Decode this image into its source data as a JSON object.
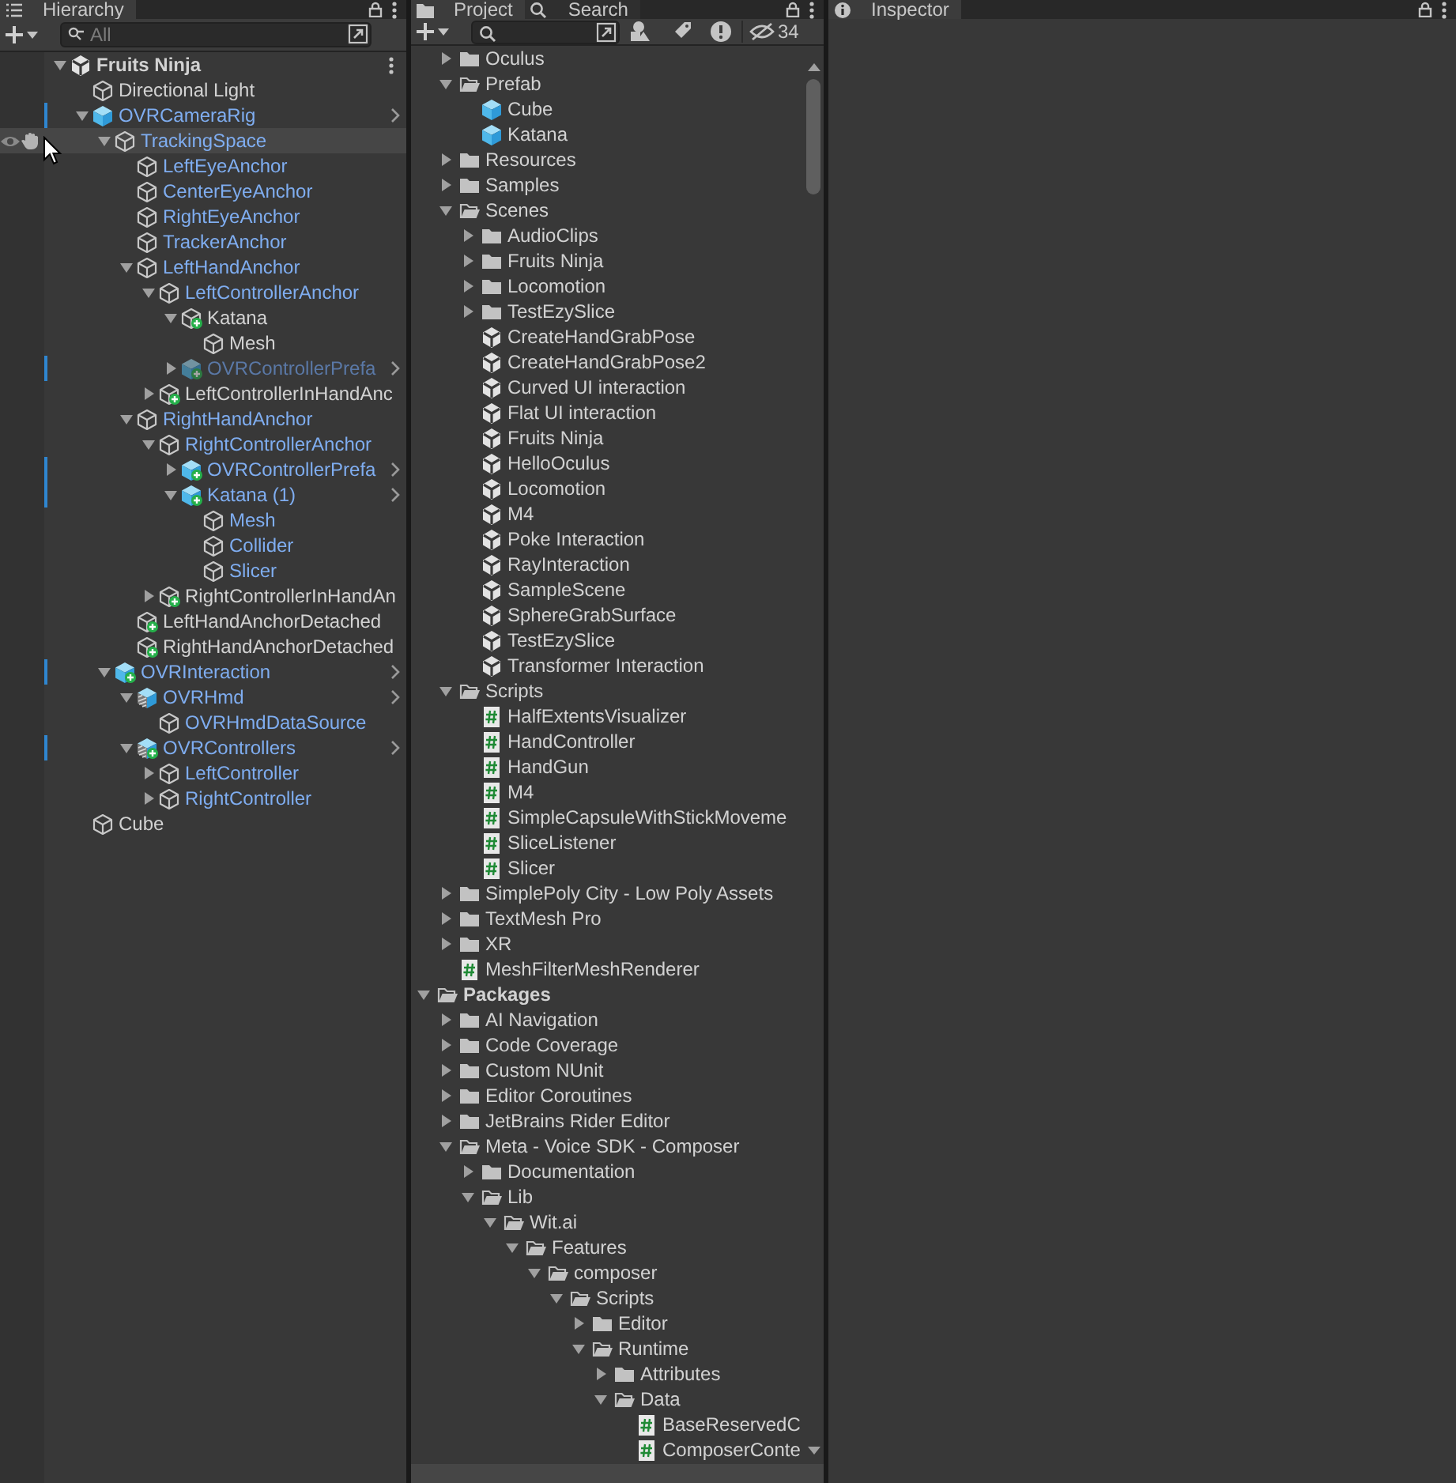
{
  "hierarchy": {
    "tab": {
      "label": "Hierarchy",
      "selected": true
    },
    "search": {
      "placeholder": "All"
    },
    "scene": {
      "name": "Fruits Ninja",
      "expanded": true,
      "children": [
        {
          "name": "Directional Light",
          "kind": "cube",
          "linked": false,
          "overridden": false,
          "chevron": false,
          "inactive": false,
          "hovered": false
        },
        {
          "name": "OVRCameraRig",
          "kind": "prefab",
          "linked": true,
          "overridden": true,
          "chevron": true,
          "inactive": false,
          "hovered": false,
          "expanded": true,
          "children": [
            {
              "name": "TrackingSpace",
              "kind": "cube",
              "linked": true,
              "overridden": false,
              "chevron": false,
              "inactive": false,
              "hovered": true,
              "expanded": true,
              "children": [
                {
                  "name": "LeftEyeAnchor",
                  "kind": "cube",
                  "linked": true,
                  "overridden": false,
                  "chevron": false,
                  "inactive": false,
                  "hovered": false
                },
                {
                  "name": "CenterEyeAnchor",
                  "kind": "cube",
                  "linked": true,
                  "overridden": false,
                  "chevron": false,
                  "inactive": false,
                  "hovered": false
                },
                {
                  "name": "RightEyeAnchor",
                  "kind": "cube",
                  "linked": true,
                  "overridden": false,
                  "chevron": false,
                  "inactive": false,
                  "hovered": false
                },
                {
                  "name": "TrackerAnchor",
                  "kind": "cube",
                  "linked": true,
                  "overridden": false,
                  "chevron": false,
                  "inactive": false,
                  "hovered": false
                },
                {
                  "name": "LeftHandAnchor",
                  "kind": "cube",
                  "linked": true,
                  "overridden": false,
                  "chevron": false,
                  "inactive": false,
                  "hovered": false,
                  "expanded": true,
                  "children": [
                    {
                      "name": "LeftControllerAnchor",
                      "kind": "cube",
                      "linked": true,
                      "overridden": false,
                      "chevron": false,
                      "inactive": false,
                      "hovered": false,
                      "expanded": true,
                      "children": [
                        {
                          "name": "Katana",
                          "kind": "cube-added",
                          "linked": false,
                          "overridden": false,
                          "chevron": false,
                          "inactive": false,
                          "hovered": false,
                          "expanded": true,
                          "children": [
                            {
                              "name": "Mesh",
                              "kind": "cube",
                              "linked": false,
                              "overridden": false,
                              "chevron": false,
                              "inactive": false,
                              "hovered": false
                            }
                          ]
                        },
                        {
                          "name": "OVRControllerPrefa",
                          "kind": "prefab-added",
                          "linked": true,
                          "overridden": true,
                          "chevron": true,
                          "inactive": true,
                          "hovered": false,
                          "expanded": false
                        }
                      ]
                    },
                    {
                      "name": "LeftControllerInHandAnc",
                      "kind": "cube-added",
                      "linked": false,
                      "overridden": false,
                      "chevron": false,
                      "inactive": false,
                      "hovered": false,
                      "expanded": false
                    }
                  ]
                },
                {
                  "name": "RightHandAnchor",
                  "kind": "cube",
                  "linked": true,
                  "overridden": false,
                  "chevron": false,
                  "inactive": false,
                  "hovered": false,
                  "expanded": true,
                  "children": [
                    {
                      "name": "RightControllerAnchor",
                      "kind": "cube",
                      "linked": true,
                      "overridden": false,
                      "chevron": false,
                      "inactive": false,
                      "hovered": false,
                      "expanded": true,
                      "children": [
                        {
                          "name": "OVRControllerPrefa",
                          "kind": "prefab-added",
                          "linked": true,
                          "overridden": true,
                          "chevron": true,
                          "inactive": false,
                          "hovered": false,
                          "expanded": false
                        },
                        {
                          "name": "Katana (1)",
                          "kind": "prefab-added",
                          "linked": true,
                          "overridden": true,
                          "chevron": true,
                          "inactive": false,
                          "hovered": false,
                          "expanded": true,
                          "children": [
                            {
                              "name": "Mesh",
                              "kind": "cube",
                              "linked": true,
                              "overridden": false,
                              "chevron": false,
                              "inactive": false,
                              "hovered": false
                            },
                            {
                              "name": "Collider",
                              "kind": "cube",
                              "linked": true,
                              "overridden": false,
                              "chevron": false,
                              "inactive": false,
                              "hovered": false
                            },
                            {
                              "name": "Slicer",
                              "kind": "cube",
                              "linked": true,
                              "overridden": false,
                              "chevron": false,
                              "inactive": false,
                              "hovered": false
                            }
                          ]
                        }
                      ]
                    },
                    {
                      "name": "RightControllerInHandAn",
                      "kind": "cube-added",
                      "linked": false,
                      "overridden": false,
                      "chevron": false,
                      "inactive": false,
                      "hovered": false,
                      "expanded": false
                    }
                  ]
                },
                {
                  "name": "LeftHandAnchorDetached",
                  "kind": "cube-added",
                  "linked": false,
                  "overridden": false,
                  "chevron": false,
                  "inactive": false,
                  "hovered": false
                },
                {
                  "name": "RightHandAnchorDetached",
                  "kind": "cube-added",
                  "linked": false,
                  "overridden": false,
                  "chevron": false,
                  "inactive": false,
                  "hovered": false
                }
              ]
            },
            {
              "name": "OVRInteraction",
              "kind": "prefab-added",
              "linked": true,
              "overridden": true,
              "chevron": true,
              "inactive": false,
              "hovered": false,
              "expanded": true,
              "children": [
                {
                  "name": "OVRHmd",
                  "kind": "variant",
                  "linked": true,
                  "overridden": false,
                  "chevron": true,
                  "inactive": false,
                  "hovered": false,
                  "expanded": true,
                  "children": [
                    {
                      "name": "OVRHmdDataSource",
                      "kind": "cube",
                      "linked": true,
                      "overridden": false,
                      "chevron": false,
                      "inactive": false,
                      "hovered": false
                    }
                  ]
                },
                {
                  "name": "OVRControllers",
                  "kind": "variant-added",
                  "linked": true,
                  "overridden": true,
                  "chevron": true,
                  "inactive": false,
                  "hovered": false,
                  "expanded": true,
                  "children": [
                    {
                      "name": "LeftController",
                      "kind": "cube",
                      "linked": true,
                      "overridden": false,
                      "chevron": false,
                      "inactive": false,
                      "hovered": false,
                      "expanded": false
                    },
                    {
                      "name": "RightController",
                      "kind": "cube",
                      "linked": true,
                      "overridden": false,
                      "chevron": false,
                      "inactive": false,
                      "hovered": false,
                      "expanded": false
                    }
                  ]
                }
              ]
            }
          ]
        },
        {
          "name": "Cube",
          "kind": "cube",
          "linked": false,
          "overridden": false,
          "chevron": false,
          "inactive": false,
          "hovered": false
        }
      ]
    }
  },
  "project": {
    "tabs": [
      {
        "label": "Project",
        "selected": true
      },
      {
        "label": "Search",
        "selected": false
      }
    ],
    "hidden_count": "34",
    "assets_items": [
      {
        "name": "Oculus",
        "kind": "folder",
        "expanded": false
      },
      {
        "name": "Prefab",
        "kind": "folder",
        "expanded": true,
        "children": [
          {
            "name": "Cube",
            "kind": "prefab"
          },
          {
            "name": "Katana",
            "kind": "prefab"
          }
        ]
      },
      {
        "name": "Resources",
        "kind": "folder",
        "expanded": false
      },
      {
        "name": "Samples",
        "kind": "folder",
        "expanded": false
      },
      {
        "name": "Scenes",
        "kind": "folder",
        "expanded": true,
        "children": [
          {
            "name": "AudioClips",
            "kind": "folder",
            "expanded": false
          },
          {
            "name": "Fruits Ninja",
            "kind": "folder",
            "expanded": false
          },
          {
            "name": "Locomotion",
            "kind": "folder",
            "expanded": false
          },
          {
            "name": "TestEzySlice",
            "kind": "folder",
            "expanded": false
          },
          {
            "name": "CreateHandGrabPose",
            "kind": "scene"
          },
          {
            "name": "CreateHandGrabPose2",
            "kind": "scene"
          },
          {
            "name": "Curved UI interaction",
            "kind": "scene"
          },
          {
            "name": "Flat UI interaction",
            "kind": "scene"
          },
          {
            "name": "Fruits Ninja",
            "kind": "scene"
          },
          {
            "name": "HelloOculus",
            "kind": "scene"
          },
          {
            "name": "Locomotion",
            "kind": "scene"
          },
          {
            "name": "M4",
            "kind": "scene"
          },
          {
            "name": "Poke Interaction",
            "kind": "scene"
          },
          {
            "name": "RayInteraction",
            "kind": "scene"
          },
          {
            "name": "SampleScene",
            "kind": "scene"
          },
          {
            "name": "SphereGrabSurface",
            "kind": "scene"
          },
          {
            "name": "TestEzySlice",
            "kind": "scene"
          },
          {
            "name": "Transformer Interaction",
            "kind": "scene"
          }
        ]
      },
      {
        "name": "Scripts",
        "kind": "folder",
        "expanded": true,
        "children": [
          {
            "name": "HalfExtentsVisualizer",
            "kind": "script"
          },
          {
            "name": "HandController",
            "kind": "script"
          },
          {
            "name": "HandGun",
            "kind": "script"
          },
          {
            "name": "M4",
            "kind": "script"
          },
          {
            "name": "SimpleCapsuleWithStickMoveme",
            "kind": "script"
          },
          {
            "name": "SliceListener",
            "kind": "script"
          },
          {
            "name": "Slicer",
            "kind": "script"
          }
        ]
      },
      {
        "name": "SimplePoly City - Low Poly Assets",
        "kind": "folder",
        "expanded": false
      },
      {
        "name": "TextMesh Pro",
        "kind": "folder",
        "expanded": false
      },
      {
        "name": "XR",
        "kind": "folder",
        "expanded": false
      },
      {
        "name": "MeshFilterMeshRenderer",
        "kind": "script"
      }
    ],
    "packages": {
      "name": "Packages",
      "kind": "folder",
      "expanded": true,
      "children": [
        {
          "name": "AI Navigation",
          "kind": "folder",
          "expanded": false
        },
        {
          "name": "Code Coverage",
          "kind": "folder",
          "expanded": false
        },
        {
          "name": "Custom NUnit",
          "kind": "folder",
          "expanded": false
        },
        {
          "name": "Editor Coroutines",
          "kind": "folder",
          "expanded": false
        },
        {
          "name": "JetBrains Rider Editor",
          "kind": "folder",
          "expanded": false
        },
        {
          "name": "Meta - Voice SDK - Composer",
          "kind": "folder",
          "expanded": true,
          "children": [
            {
              "name": "Documentation",
              "kind": "folder",
              "expanded": false
            },
            {
              "name": "Lib",
              "kind": "folder",
              "expanded": true,
              "children": [
                {
                  "name": "Wit.ai",
                  "kind": "folder",
                  "expanded": true,
                  "children": [
                    {
                      "name": "Features",
                      "kind": "folder",
                      "expanded": true,
                      "children": [
                        {
                          "name": "composer",
                          "kind": "folder",
                          "expanded": true,
                          "children": [
                            {
                              "name": "Scripts",
                              "kind": "folder",
                              "expanded": true,
                              "children": [
                                {
                                  "name": "Editor",
                                  "kind": "folder",
                                  "expanded": false
                                },
                                {
                                  "name": "Runtime",
                                  "kind": "folder",
                                  "expanded": true,
                                  "children": [
                                    {
                                      "name": "Attributes",
                                      "kind": "folder",
                                      "expanded": false
                                    },
                                    {
                                      "name": "Data",
                                      "kind": "folder",
                                      "expanded": true,
                                      "children": [
                                        {
                                          "name": "BaseReservedC",
                                          "kind": "script"
                                        },
                                        {
                                          "name": "ComposerConte",
                                          "kind": "script"
                                        }
                                      ]
                                    }
                                  ]
                                }
                              ]
                            }
                          ]
                        }
                      ]
                    }
                  ]
                }
              ]
            }
          ]
        }
      ]
    }
  },
  "inspector": {
    "tab": {
      "label": "Inspector",
      "selected": true
    }
  }
}
